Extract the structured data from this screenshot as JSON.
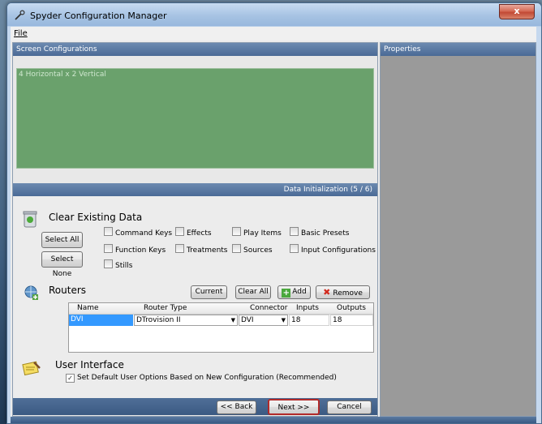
{
  "window": {
    "title": "Spyder Configuration Manager",
    "close_label": "x"
  },
  "menu": {
    "file": "File"
  },
  "screen_config": {
    "header": "Screen Configurations",
    "items": [
      "4 Horizontal x 2 Vertical"
    ]
  },
  "properties": {
    "header": "Properties"
  },
  "wizard": {
    "step_label": "Data Initialization (5 / 6)"
  },
  "clear_data": {
    "title": "Clear Existing Data",
    "select_all": "Select All",
    "select_none": "Select None",
    "checkboxes": [
      "Command Keys",
      "Effects",
      "Play Items",
      "Basic Presets",
      "Function Keys",
      "Treatments",
      "Sources",
      "Input Configurations",
      "Stills"
    ]
  },
  "routers": {
    "title": "Routers",
    "current": "Current",
    "clear_all": "Clear All",
    "add": "Add",
    "remove": "Remove",
    "columns": [
      "Name",
      "Router Type",
      "Connector",
      "Inputs",
      "Outputs"
    ],
    "rows": [
      {
        "name": "DVI",
        "router_type": "DTrovision II",
        "connector": "DVI",
        "inputs": "18",
        "outputs": "18"
      }
    ]
  },
  "user_interface": {
    "title": "User Interface",
    "option": "Set Default User Options Based on New Configuration (Recommended)"
  },
  "nav": {
    "back": "<< Back",
    "next": "Next >>",
    "cancel": "Cancel"
  }
}
